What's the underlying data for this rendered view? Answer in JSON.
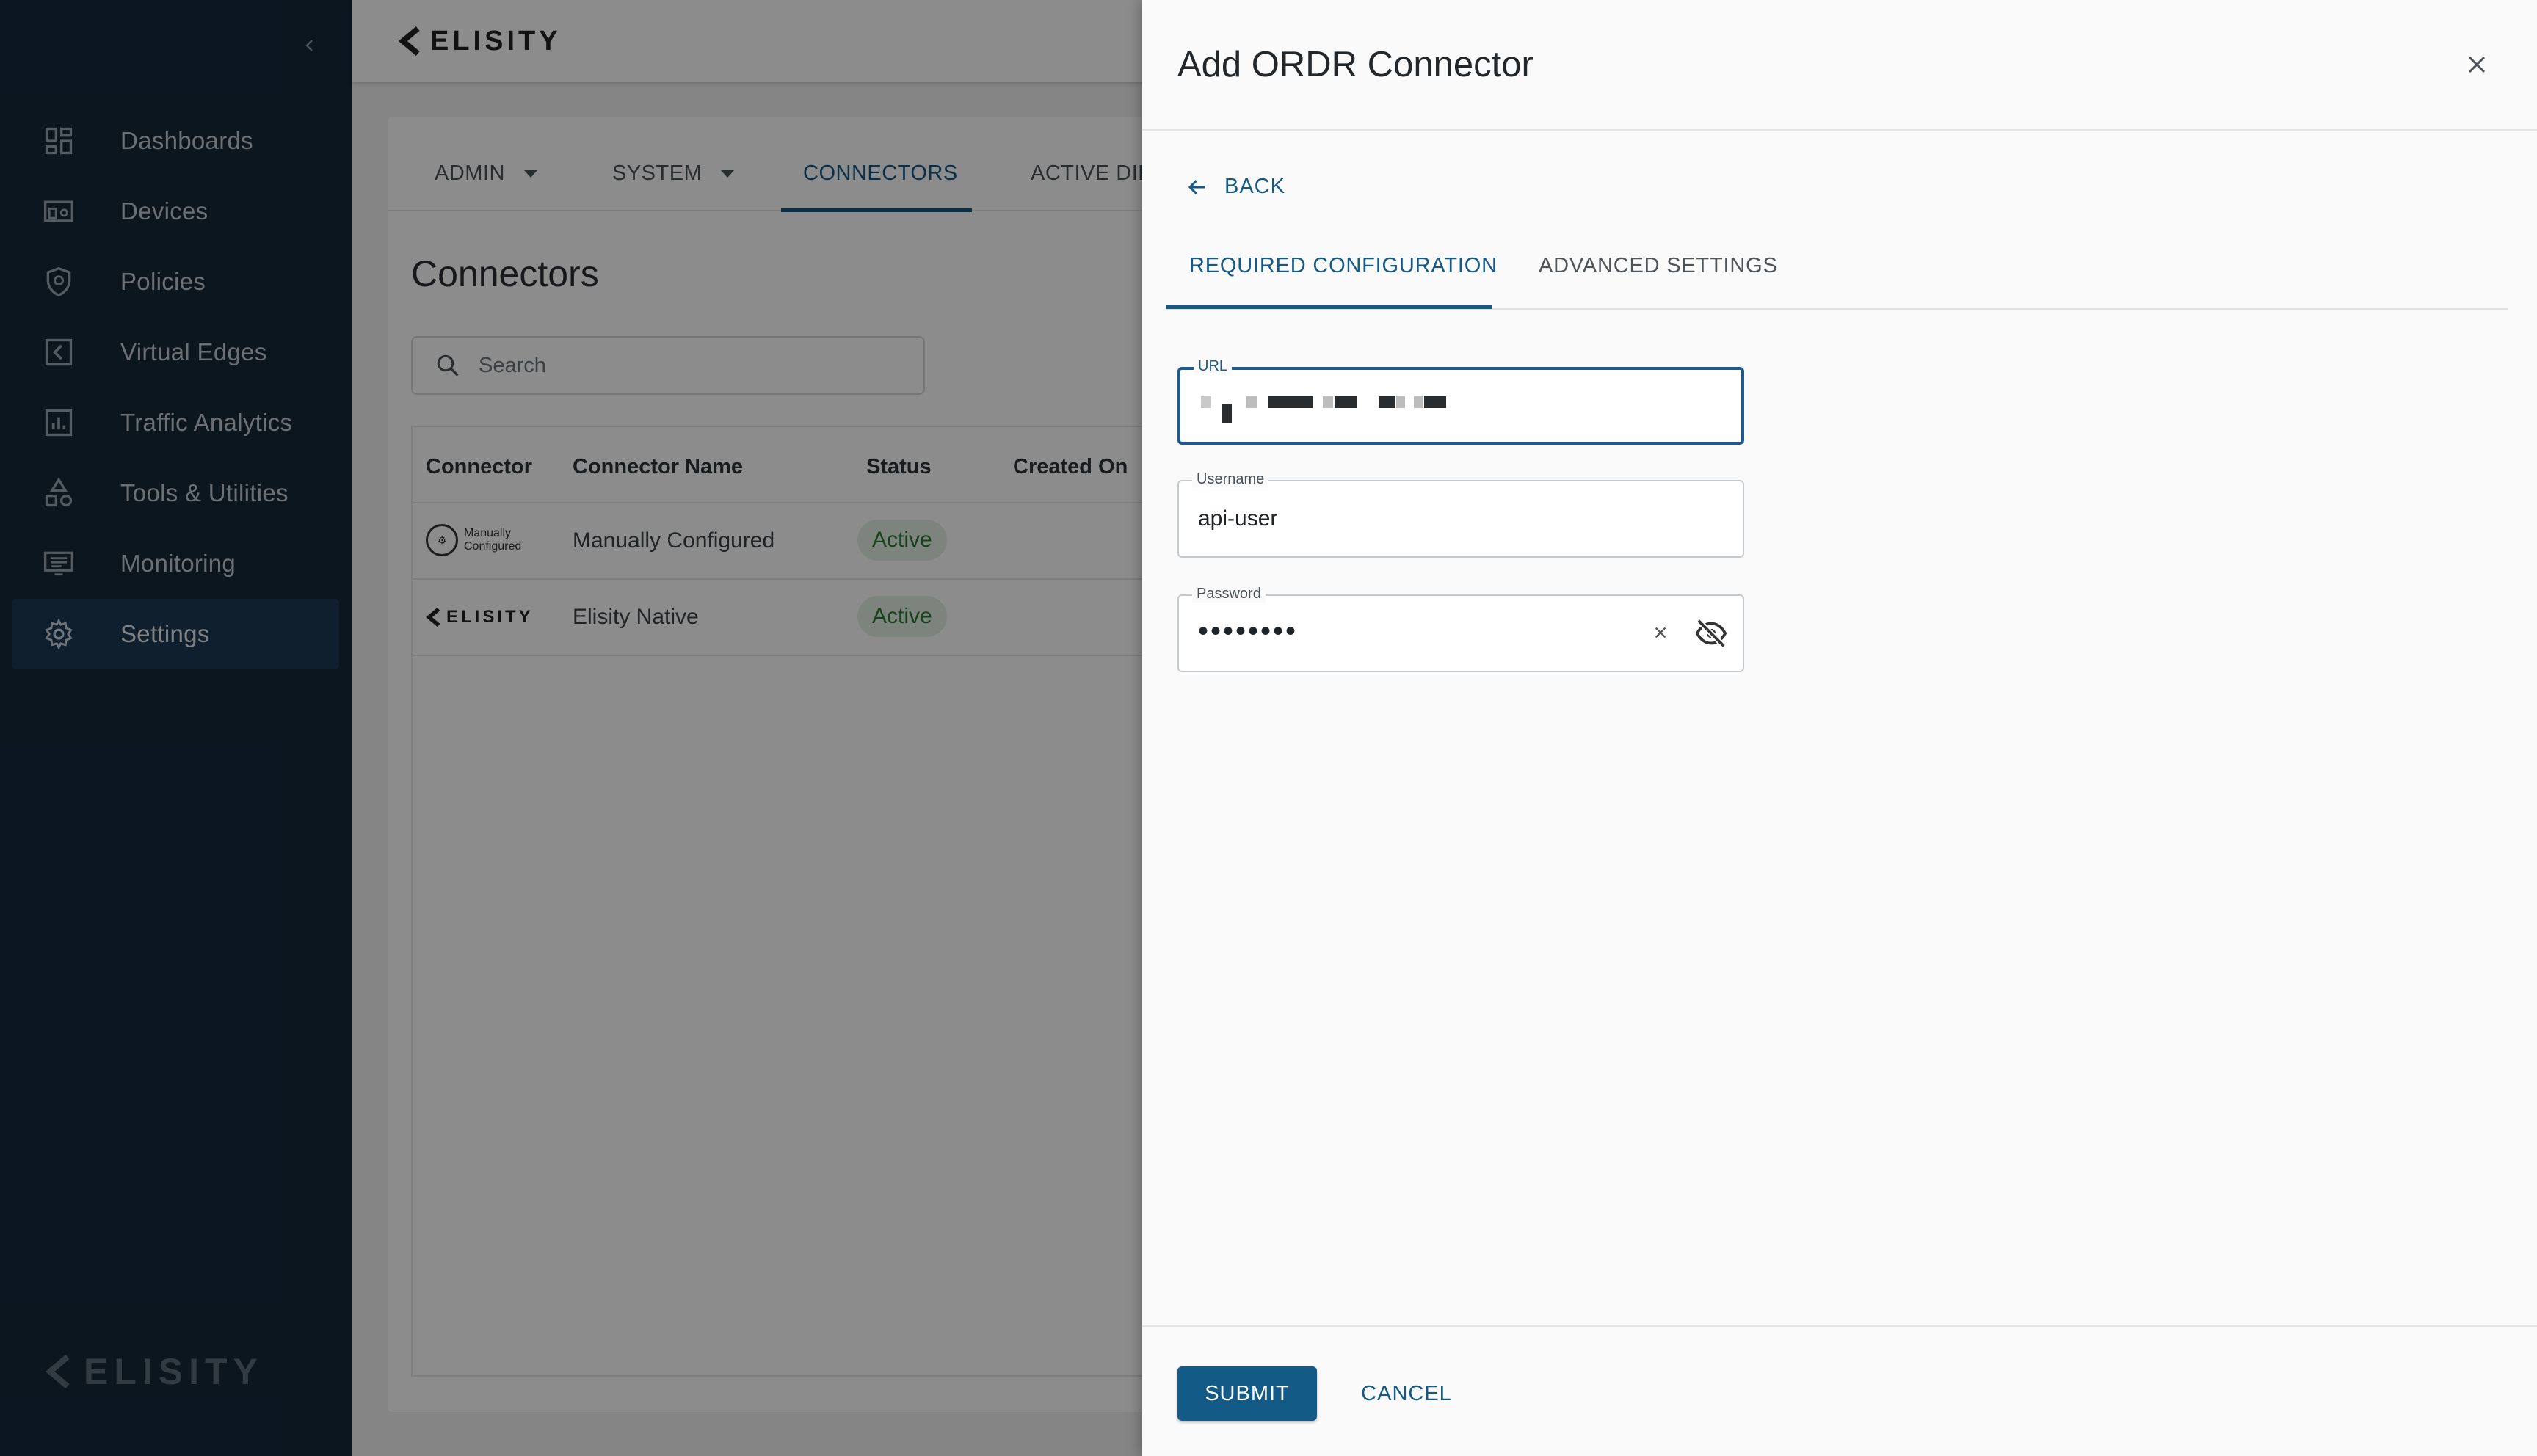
{
  "sidebar": {
    "items": [
      {
        "label": "Dashboards",
        "icon": "dashboard-icon"
      },
      {
        "label": "Devices",
        "icon": "devices-icon"
      },
      {
        "label": "Policies",
        "icon": "shield-icon"
      },
      {
        "label": "Virtual Edges",
        "icon": "virtual-edge-icon"
      },
      {
        "label": "Traffic Analytics",
        "icon": "bar-chart-icon"
      },
      {
        "label": "Tools & Utilities",
        "icon": "tools-icon"
      },
      {
        "label": "Monitoring",
        "icon": "monitor-icon"
      },
      {
        "label": "Settings",
        "icon": "gear-icon"
      }
    ],
    "active_index": 7,
    "logo_text": "ELISITY"
  },
  "topbar": {
    "logo_text": "ELISITY"
  },
  "main": {
    "tabs": [
      {
        "label": "ADMIN",
        "has_caret": true
      },
      {
        "label": "SYSTEM",
        "has_caret": true
      },
      {
        "label": "CONNECTORS",
        "active": true
      },
      {
        "label": "ACTIVE DIRECT"
      }
    ],
    "page_title": "Connectors",
    "search_placeholder": "Search",
    "table": {
      "headers": [
        "Connector",
        "Connector Name",
        "Status",
        "Created On"
      ],
      "rows": [
        {
          "logo_line1": "Manually",
          "logo_line2": "Configured",
          "name": "Manually Configured",
          "status": "Active"
        },
        {
          "logo_text": "ELISITY",
          "name": "Elisity Native",
          "status": "Active"
        }
      ]
    }
  },
  "drawer": {
    "title": "Add ORDR Connector",
    "back_label": "BACK",
    "tabs": [
      {
        "label": "REQUIRED CONFIGURATION",
        "active": true
      },
      {
        "label": "ADVANCED SETTINGS"
      }
    ],
    "fields": {
      "url_label": "URL",
      "username_label": "Username",
      "username_value": "api-user",
      "password_label": "Password",
      "password_masked": "••••••••"
    },
    "submit_label": "SUBMIT",
    "cancel_label": "CANCEL"
  },
  "colors": {
    "sidebar_bg": "#16283a",
    "accent": "#155a87",
    "status_active_bg": "#e3f1e3",
    "status_active_text": "#2b7a34"
  }
}
